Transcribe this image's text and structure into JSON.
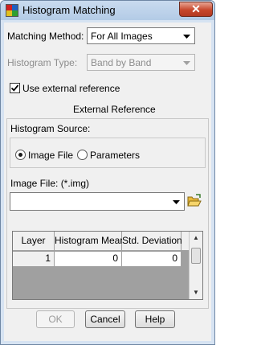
{
  "window": {
    "title": "Histogram Matching",
    "close_glyph": "✕"
  },
  "matching_method": {
    "label": "Matching Method:",
    "value": "For All Images"
  },
  "histogram_type": {
    "label": "Histogram Type:",
    "value": "Band by Band"
  },
  "use_external_reference": {
    "label": "Use external reference",
    "checked": true
  },
  "external_reference": {
    "title": "External Reference",
    "source_label": "Histogram Source:",
    "options": [
      {
        "label": "Image File",
        "selected": true
      },
      {
        "label": "Parameters",
        "selected": false
      }
    ],
    "image_file_label": "Image File: (*.img)",
    "image_file_value": ""
  },
  "table": {
    "columns": [
      "Layer",
      "Histogram Mean",
      "Std. Deviation"
    ],
    "rows": [
      {
        "layer": "1",
        "mean": "0",
        "std": "0"
      }
    ]
  },
  "buttons": {
    "ok": "OK",
    "cancel": "Cancel",
    "help": "Help"
  },
  "icons": [
    "app-icon",
    "close-icon",
    "dropdown-arrow-icon",
    "folder-open-icon",
    "scroll-up-icon",
    "scroll-down-icon"
  ]
}
